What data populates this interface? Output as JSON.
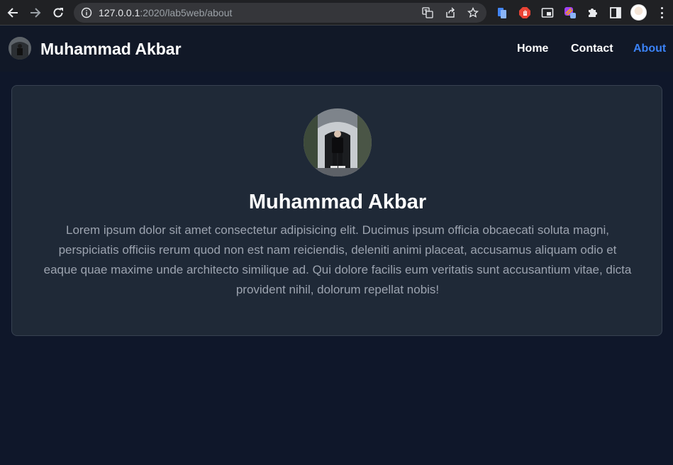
{
  "browser": {
    "url_host": "127.0.0.1",
    "url_rest": ":2020/lab5web/about"
  },
  "navbar": {
    "brand_name": "Muhammad Akbar",
    "links": [
      {
        "label": "Home",
        "active": false
      },
      {
        "label": "Contact",
        "active": false
      },
      {
        "label": "About",
        "active": true
      }
    ]
  },
  "profile": {
    "name": "Muhammad Akbar",
    "bio": "Lorem ipsum dolor sit amet consectetur adipisicing elit. Ducimus ipsum officia obcaecati soluta magni, perspiciatis officiis rerum quod non est nam reiciendis, deleniti animi placeat, accusamus aliquam odio et eaque quae maxime unde architecto similique ad. Qui dolore facilis eum veritatis sunt accusantium vitae, dicta provident nihil, dolorum repellat nobis!"
  },
  "icons": {
    "back": "arrow-left-icon",
    "forward": "arrow-right-icon",
    "reload": "reload-icon",
    "site_info": "info-icon",
    "translate": "translate-icon",
    "share": "share-icon",
    "bookmark": "star-icon",
    "extensions": "puzzle-icon",
    "side_panel": "side-panel-icon",
    "menu": "kebab-menu-icon"
  },
  "colors": {
    "page_bg": "#0f172a",
    "navbar_bg": "#111827",
    "card_bg": "#1f2937",
    "active_link": "#3b82f6",
    "bio_text": "#9ca3af"
  }
}
